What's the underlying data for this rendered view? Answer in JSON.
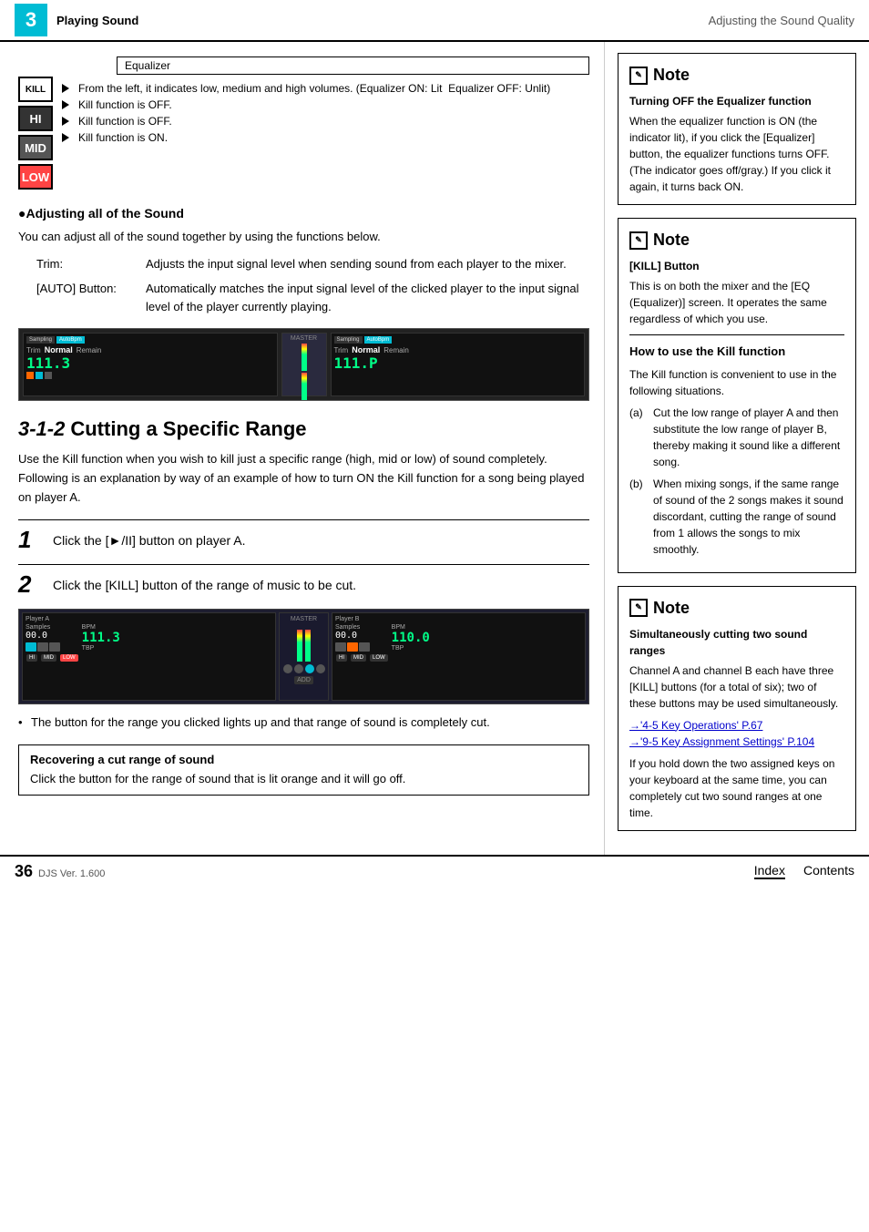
{
  "header": {
    "chapter_num": "3",
    "section": "Playing Sound",
    "title": "Adjusting the Sound Quality"
  },
  "eq_section": {
    "eq_label": "Equalizer",
    "rows": [
      {
        "button_label": "KILL",
        "button_class": "kill",
        "arrow_text": "From the left, it indicates low, medium and high volumes. (Equalizer ON: Lit  Equalizer OFF: Unlit)"
      },
      {
        "button_label": "HI",
        "button_class": "hi",
        "arrow_text": "Kill function is OFF."
      },
      {
        "button_label": "MID",
        "button_class": "mid",
        "arrow_text": "Kill function is OFF."
      },
      {
        "button_label": "LOW",
        "button_class": "low",
        "arrow_text": "Kill function is ON."
      }
    ]
  },
  "adjusting_all": {
    "heading": "●Adjusting all of the Sound",
    "body": "You can adjust all of the sound together by using the functions below.",
    "trim_label": "Trim:",
    "trim_desc": "Adjusts the input signal level when sending sound from each player to the mixer.",
    "auto_label": "[AUTO] Button:",
    "auto_desc": "Automatically matches the input signal level of the clicked player to the input signal level of the player currently playing."
  },
  "section_312": {
    "num": "3-1-2",
    "title": "Cutting a Specific Range",
    "body": "Use the Kill function when you wish to kill just a specific range (high, mid or low) of sound completely. Following is an explanation by way of an example of how to turn ON the Kill function for a song being played on player A.",
    "step1_num": "1",
    "step1_text": "Click the [►/II] button on player A.",
    "step2_num": "2",
    "step2_text": "Click the [KILL] button of the range of music to be cut.",
    "bullet_text": "The button for the range you clicked lights up and that range of sound is completely cut.",
    "recover_title": "Recovering a cut range of sound",
    "recover_text": "Click the button for the range of sound that is lit orange and it will go off."
  },
  "note1": {
    "word": "Note",
    "subtitle": "Turning OFF the Equalizer function",
    "text": "When the equalizer function is ON (the indicator lit), if you click the [Equalizer] button, the equalizer functions turns OFF. (The indicator goes off/gray.) If you click it again, it turns back ON."
  },
  "note2": {
    "word": "Note",
    "subtitle1": "[KILL] Button",
    "text1": "This is on both the mixer and the [EQ (Equalizer)] screen. It operates the same regardless of which you use.",
    "subtitle2": "How to use the Kill function",
    "kill_intro": "The Kill function is convenient to use in the following situations.",
    "items": [
      {
        "label": "(a)",
        "text": "Cut the low range of player A and then substitute the low range of player B, thereby making it sound like a different song."
      },
      {
        "label": "(b)",
        "text": "When mixing songs, if the same range of sound of the 2 songs makes it sound discordant, cutting the range of sound from 1 allows the songs to mix smoothly."
      }
    ]
  },
  "note3": {
    "word": "Note",
    "subtitle": "Simultaneously cutting two sound ranges",
    "text1": "Channel A and channel B each have three [KILL] buttons (for a total of six); two of these buttons may be used simultaneously.",
    "link1": "→'4-5 Key Operations' P.67",
    "link2": "→'9-5 Key Assignment Settings' P.104",
    "text2": "If you hold down the two assigned keys on your keyboard at the same time, you can completely cut two sound ranges at one time."
  },
  "footer": {
    "page_num": "36",
    "version": "DJS Ver. 1.600",
    "index_label": "Index",
    "contents_label": "Contents"
  }
}
